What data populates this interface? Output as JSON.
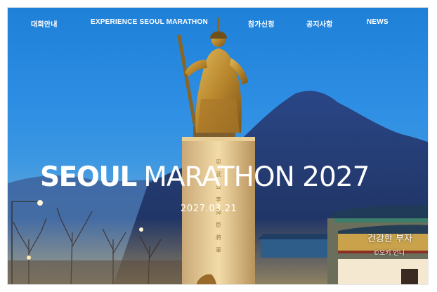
{
  "nav": {
    "items": [
      {
        "label": "대회안내"
      },
      {
        "label": "EXPERIENCE SEOUL MARATHON"
      },
      {
        "label": "참가신청"
      },
      {
        "label": "공지사항"
      },
      {
        "label": "NEWS"
      }
    ]
  },
  "hero": {
    "title_bold": "SEOUL",
    "title_light": "MARATHON 2027",
    "date": "2027.03.21"
  },
  "photo_caption": {
    "title": "건강한 부자",
    "subtitle": "©오키 언니"
  },
  "colors": {
    "sky": "#2d8ee3",
    "text": "#ffffff",
    "mountain": "#283f73",
    "statue": "#c49a3c"
  }
}
